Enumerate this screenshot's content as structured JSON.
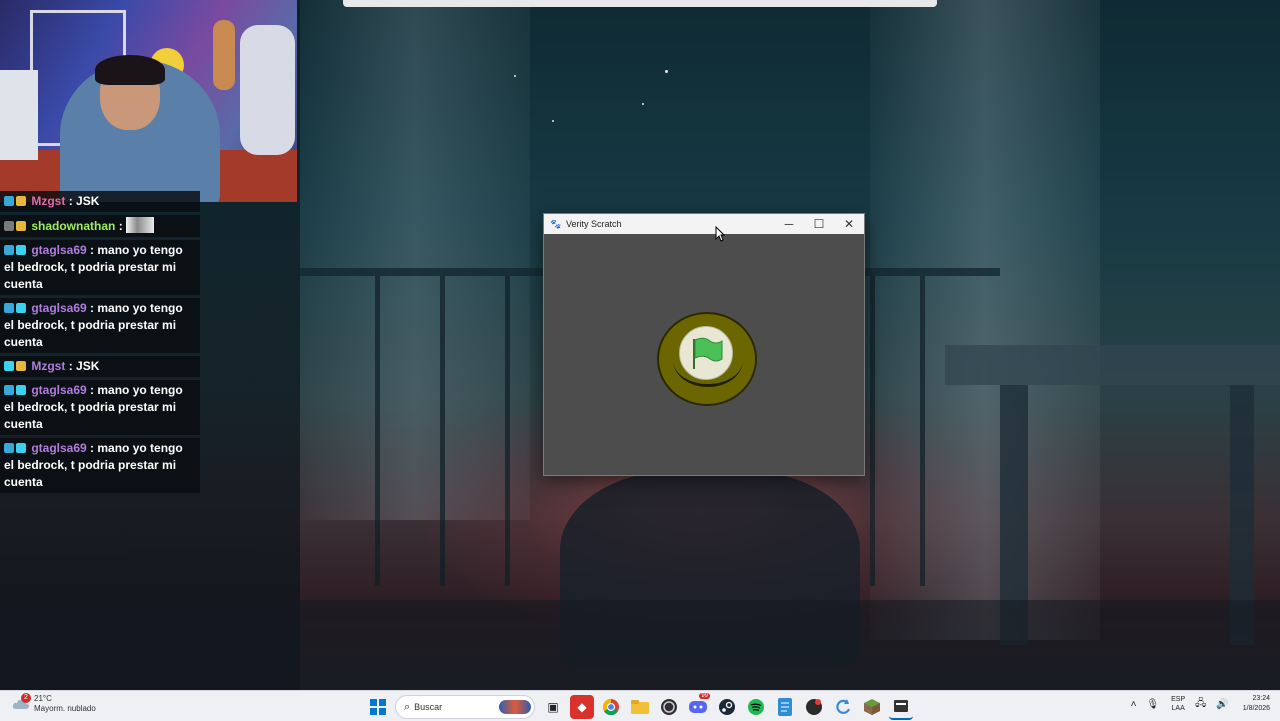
{
  "window": {
    "title": "Verity Scratch",
    "buttons": {
      "minimize": "─",
      "maximize": "☐",
      "close": "✕"
    },
    "icon": "app-icon"
  },
  "chat": {
    "messages": [
      {
        "user": "Mzgst",
        "text": ": JSK",
        "color": "#e06aa8"
      },
      {
        "user": "shadownathan",
        "text": ":",
        "color": "#9cf05a",
        "emote": true
      },
      {
        "user": "gtaglsa69",
        "text": ": mano yo tengo el bedrock, t podria prestar mi cuenta",
        "color": "#b17de0"
      },
      {
        "user": "gtaglsa69",
        "text": ": mano yo tengo el bedrock, t podria prestar mi cuenta",
        "color": "#b17de0"
      },
      {
        "user": "Mzgst",
        "text": ": JSK",
        "color": "#b17de0"
      },
      {
        "user": "gtaglsa69",
        "text": ": mano yo tengo el bedrock, t podria prestar mi cuenta",
        "color": "#b17de0"
      },
      {
        "user": "gtaglsa69",
        "text": ": mano yo tengo el bedrock, t podria prestar mi cuenta",
        "color": "#b17de0"
      }
    ]
  },
  "taskbar": {
    "weather": {
      "temp": "21°C",
      "desc": "Mayorm. nublado",
      "badge": "2"
    },
    "search_placeholder": "Buscar",
    "language": {
      "line1": "ESP",
      "line2": "LAA"
    },
    "clock": {
      "time": "23:24",
      "date": "1/8/2026"
    },
    "discord_badge": "99"
  },
  "colors": {
    "accent": "#0067c0",
    "flag_disc": "#6b6600",
    "flag_green": "#4cbf56"
  }
}
